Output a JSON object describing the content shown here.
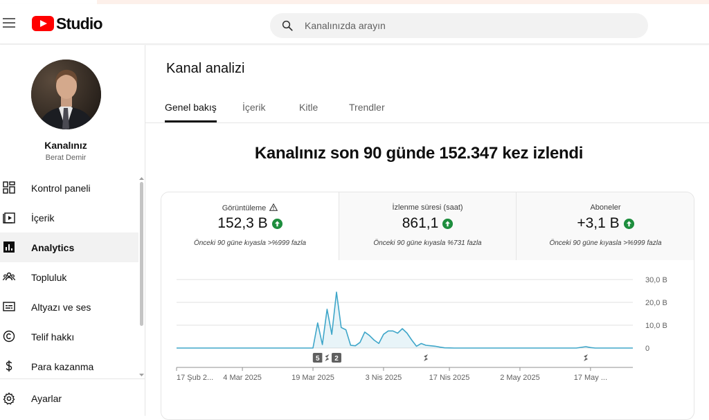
{
  "header": {
    "logo_text": "Studio",
    "search_placeholder": "Kanalınızda arayın"
  },
  "sidebar": {
    "channel_name": "Kanalınız",
    "channel_owner": "Berat Demir",
    "items": [
      {
        "label": "Kontrol paneli",
        "icon": "dashboard-icon"
      },
      {
        "label": "İçerik",
        "icon": "content-icon"
      },
      {
        "label": "Analytics",
        "icon": "analytics-icon",
        "active": true
      },
      {
        "label": "Topluluk",
        "icon": "community-icon"
      },
      {
        "label": "Altyazı ve ses",
        "icon": "subtitles-icon"
      },
      {
        "label": "Telif hakkı",
        "icon": "copyright-icon"
      },
      {
        "label": "Para kazanma",
        "icon": "monetization-icon"
      }
    ],
    "settings_label": "Ayarlar"
  },
  "main": {
    "title": "Kanal analizi",
    "tabs": [
      {
        "label": "Genel bakış",
        "active": true
      },
      {
        "label": "İçerik"
      },
      {
        "label": "Kitle"
      },
      {
        "label": "Trendler"
      }
    ],
    "headline": "Kanalınız son 90 günde 152.347 kez izlendi",
    "metrics": [
      {
        "label": "Görüntüleme",
        "value": "152,3 B",
        "comparison": "Önceki 90 güne kıyasla >%999 fazla",
        "trend": "up"
      },
      {
        "label": "İzlenme süresi (saat)",
        "value": "861,1",
        "comparison": "Önceki 90 güne kıyasla %731 fazla",
        "trend": "up"
      },
      {
        "label": "Aboneler",
        "value": "+3,1 B",
        "comparison": "Önceki 90 güne kıyasla >%999 fazla",
        "trend": "up"
      }
    ]
  },
  "colors": {
    "accent": "#ff0000",
    "positive": "#1e8e3e",
    "line": "#3ea6c9"
  },
  "chart_data": {
    "type": "area",
    "x_tick_labels": [
      "17 Şub 2...",
      "4 Mar 2025",
      "19 Mar 2025",
      "3 Nis 2025",
      "17 Nis 2025",
      "2 May 2025",
      "17 May ..."
    ],
    "y_tick_labels": [
      "30,0 B",
      "20,0 B",
      "10,0 B",
      "0"
    ],
    "ylim": [
      0,
      30000
    ],
    "x_start": "2025-02-17",
    "series": [
      {
        "values": [
          0,
          0,
          0,
          0,
          0,
          0,
          0,
          0,
          0,
          0,
          0,
          0,
          0,
          0,
          0,
          0,
          0,
          0,
          0,
          0,
          0,
          0,
          0,
          0,
          0,
          0,
          0,
          0,
          0,
          0,
          11000,
          1500,
          17000,
          6000,
          24500,
          9000,
          8000,
          1200,
          1000,
          2500,
          7000,
          5500,
          3500,
          2000,
          6000,
          7500,
          7500,
          6500,
          8500,
          6500,
          3500,
          800,
          2000,
          1200,
          1000,
          800,
          400,
          100,
          50,
          0,
          0,
          0,
          0,
          0,
          0,
          0,
          0,
          0,
          0,
          0,
          0,
          0,
          0,
          0,
          0,
          0,
          0,
          0,
          0,
          0,
          0,
          0,
          0,
          0,
          0,
          0,
          300,
          600,
          200,
          0,
          0,
          0,
          0,
          0,
          0,
          0,
          0,
          0
        ]
      }
    ],
    "markers": [
      {
        "date": "2025-03-19",
        "label": "5"
      },
      {
        "date": "2025-03-21",
        "label": ""
      },
      {
        "date": "2025-03-23",
        "label": "2"
      },
      {
        "date": "2025-04-11",
        "label": ""
      },
      {
        "date": "2025-05-15",
        "label": ""
      }
    ],
    "grid": true
  }
}
